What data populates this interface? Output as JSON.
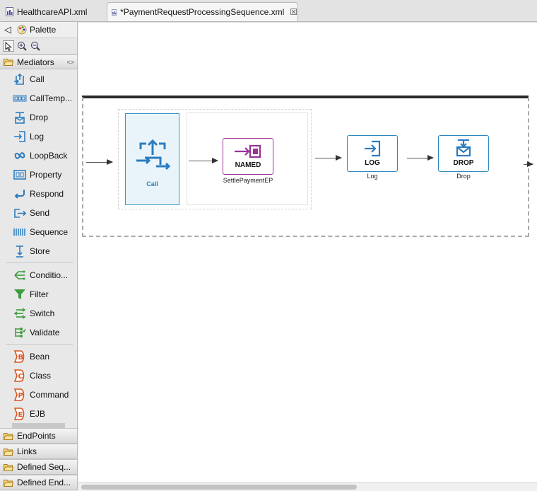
{
  "tabs": [
    {
      "label": "HealthcareAPI.xml",
      "active": false
    },
    {
      "label": "*PaymentRequestProcessingSequence.xml",
      "active": true
    }
  ],
  "palette": {
    "title": "Palette",
    "mediators_drawer": "Mediators",
    "core_items": [
      "Call",
      "CallTemp...",
      "Drop",
      "Log",
      "LoopBack",
      "Property",
      "Respond",
      "Send",
      "Sequence",
      "Store"
    ],
    "filter_items": [
      "Conditio...",
      "Filter",
      "Switch",
      "Validate"
    ],
    "ext_items": [
      "Bean",
      "Class",
      "Command",
      "EJB"
    ],
    "bottom_drawers": [
      "EndPoints",
      "Links",
      "Defined Seq...",
      "Defined End..."
    ]
  },
  "diagram": {
    "call": {
      "label": "Call"
    },
    "endpoint": {
      "title": "NAMED",
      "subtitle": "SettlePaymentEP"
    },
    "log": {
      "title": "LOG",
      "subtitle": "Log"
    },
    "drop": {
      "title": "DROP",
      "subtitle": "Drop"
    }
  },
  "colors": {
    "accent_blue": "#2a8ac0",
    "endpoint_purple": "#993399",
    "core_icon_blue": "#2b7cc0",
    "filter_icon_green": "#3e9b3e",
    "ext_icon_orange": "#d9531e"
  }
}
